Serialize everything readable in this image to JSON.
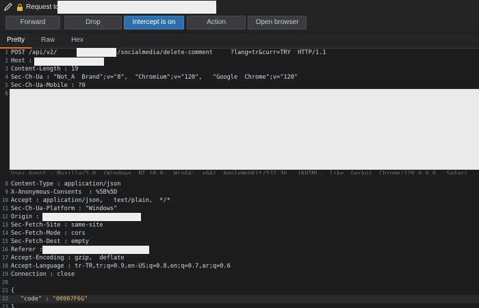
{
  "header": {
    "title": "Request to"
  },
  "toolbar": {
    "forward": "Forward",
    "drop": "Drop",
    "intercept": "Intercept is on",
    "action": "Action",
    "open_browser": "Open browser"
  },
  "tabs": [
    "Pretty",
    "Raw",
    "Hex"
  ],
  "lines": [
    {
      "n": "1",
      "t": "POST /api/v2/              gys/socialmedia/delete-comment     ?lang=tr&curr=TRY  HTTP/1.1"
    },
    {
      "n": "2",
      "t": "Host :"
    },
    {
      "n": "3",
      "t": "Content-Length : 19"
    },
    {
      "n": "4",
      "t": "Sec-Ch-Ua : \"Not_A  Brand\";v=\"8\",  \"Chromium\";v=\"120\",   \"Google  Chrome\";v=\"120\""
    },
    {
      "n": "5",
      "t": "Sec-Ch-Ua-Mobile : ?0"
    },
    {
      "n": "6",
      "t": ""
    },
    {
      "n": "8",
      "t": "Content-Type : application/json"
    },
    {
      "n": "9",
      "t": "X-Anonymous-Consents  : %5B%5D"
    },
    {
      "n": "10",
      "t": "Accept : application/json,   text/plain,  */*"
    },
    {
      "n": "11",
      "t": "Sec-Ch-Ua-Platform : \"Windows\""
    },
    {
      "n": "12",
      "t": "Origin :"
    },
    {
      "n": "13",
      "t": "Sec-Fetch-Site : same-site"
    },
    {
      "n": "14",
      "t": "Sec-Fetch-Mode : cors"
    },
    {
      "n": "15",
      "t": "Sec-Fetch-Dest : empty"
    },
    {
      "n": "16",
      "t": "Referer :"
    },
    {
      "n": "17",
      "t": "Accept-Encoding : gzip,  deflate"
    },
    {
      "n": "18",
      "t": "Accept-Language : tr-TR,tr;q=0.9,en-US;q=0.8,en;q=0.7,ar;q=0.6"
    },
    {
      "n": "19",
      "t": "Connection : close"
    },
    {
      "n": "20",
      "t": ""
    },
    {
      "n": "21",
      "t": "{"
    },
    {
      "n": "22",
      "t": ""
    },
    {
      "n": "23",
      "t": "}"
    }
  ],
  "ua_fragment": "User-Agent : Mozilla/5.0  (Windows  NT 10.0;  Win64;  x64)  AppleWebKit/537.36   (KHTML,  like  Gecko)  Chrome/120.0.0.0   Safari",
  "json_body": {
    "key": "\"code\"",
    "sep": " : ",
    "value": "\"00007F6G\""
  },
  "colors": {
    "accent": "#2f6ea9",
    "tab_underline": "#e8712d",
    "string": "#e6c07b"
  }
}
